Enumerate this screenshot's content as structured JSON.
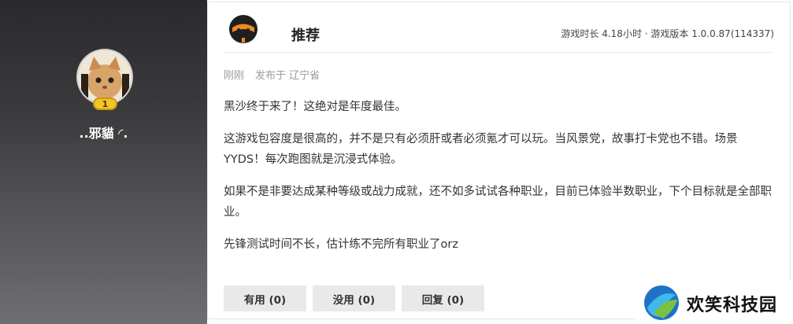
{
  "user": {
    "name": "..邪貓 ◜.",
    "level": "1"
  },
  "review": {
    "tag": "推荐",
    "playtime_info": "游戏时长 4.18小时 · 游戏版本 1.0.0.87(114337)",
    "time": "刚刚",
    "location": "发布于 辽宁省",
    "paragraphs": [
      "黑沙终于来了！这绝对是年度最佳。",
      "这游戏包容度是很高的，并不是只有必须肝或者必须氪才可以玩。当风景党，故事打卡党也不错。场景YYDS！每次跑图就是沉浸式体验。",
      "如果不是非要达成某种等级或战力成就，还不如多试试各种职业，目前已体验半数职业，下个目标就是全部职业。",
      "先锋测试时间不长，估计练不完所有职业了orz"
    ]
  },
  "actions": {
    "useful": "有用 (0)",
    "useless": "没用 (0)",
    "reply": "回复 (0)"
  },
  "watermark": {
    "text": "欢笑科技园"
  },
  "colors": {
    "badge": "#f3c623",
    "button_bg": "#e9e9e9",
    "panel_dark": "#2a2a2c"
  },
  "icons": [
    "cat-avatar",
    "level-badge-icon",
    "recommend-icon",
    "watermark-logo"
  ]
}
